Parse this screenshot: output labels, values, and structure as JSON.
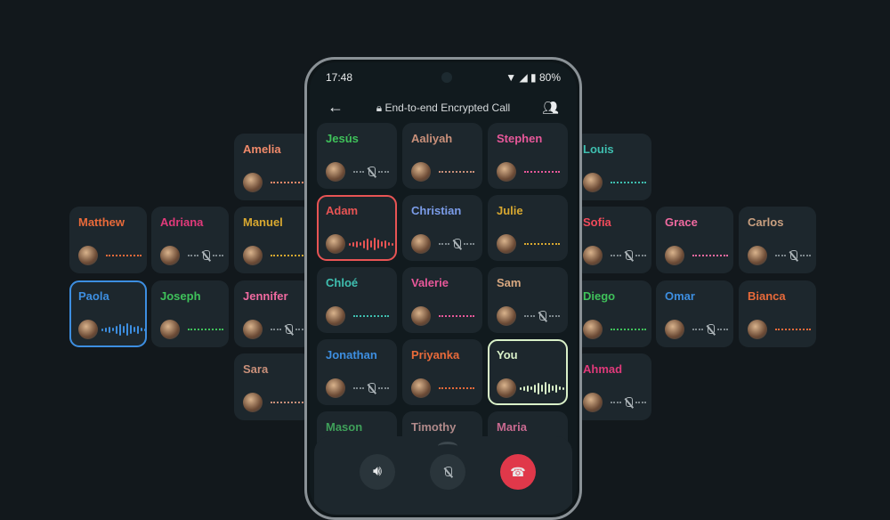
{
  "status_bar": {
    "time": "17:48",
    "battery": "80%",
    "icons": [
      "wifi-icon",
      "signal-icon",
      "battery-icon"
    ]
  },
  "header": {
    "back_icon": "arrow-left-icon",
    "lock_icon": "lock-icon",
    "title": "End-to-end Encrypted Call",
    "participants_icon": "people-icon"
  },
  "controls": {
    "speaker_icon": "speaker-icon",
    "mute_icon": "mic-off-icon",
    "end_call_icon": "phone-hangup-icon",
    "expand_icon": "chevron-up-icon",
    "end_call_color": "#e0384a"
  },
  "phone_tiles": [
    {
      "name": "Jesús",
      "color": "#3fc15a",
      "state": "muted"
    },
    {
      "name": "Aaliyah",
      "color": "#c9907a",
      "state": "dots"
    },
    {
      "name": "Stephen",
      "color": "#e8589a",
      "state": "dots"
    },
    {
      "name": "Adam",
      "color": "#e85454",
      "state": "speaking"
    },
    {
      "name": "Christian",
      "color": "#7b9ce8",
      "state": "muted"
    },
    {
      "name": "Julie",
      "color": "#d8a830",
      "state": "dots"
    },
    {
      "name": "Chloé",
      "color": "#3fbfb0",
      "state": "dots"
    },
    {
      "name": "Valerie",
      "color": "#e8589a",
      "state": "dots"
    },
    {
      "name": "Sam",
      "color": "#d8a880",
      "state": "muted"
    },
    {
      "name": "Jonathan",
      "color": "#3d8ee0",
      "state": "muted"
    },
    {
      "name": "Priyanka",
      "color": "#e86a3a",
      "state": "dots"
    },
    {
      "name": "You",
      "color": "#d9f0c8",
      "state": "speaking"
    },
    {
      "name": "Mason",
      "color": "#3fa05a",
      "state": "dots"
    },
    {
      "name": "Timothy",
      "color": "#b08a8a",
      "state": "dots"
    },
    {
      "name": "Maria",
      "color": "#c86a90",
      "state": "dots"
    }
  ],
  "left_tiles": [
    {
      "name": "Amelia",
      "color": "#f08a6a",
      "state": "dots"
    },
    {
      "name": "Matthew",
      "color": "#e86a3a",
      "state": "dots"
    },
    {
      "name": "Adriana",
      "color": "#e03a7a",
      "state": "muted"
    },
    {
      "name": "Manuel",
      "color": "#d8a830",
      "state": "dots"
    },
    {
      "name": "Paola",
      "color": "#3d8ee0",
      "state": "speaking"
    },
    {
      "name": "Joseph",
      "color": "#3fc15a",
      "state": "dots"
    },
    {
      "name": "Jennifer",
      "color": "#f06aa0",
      "state": "muted"
    },
    {
      "name": "Sara",
      "color": "#c9907a",
      "state": "dots"
    }
  ],
  "right_tiles": [
    {
      "name": "Louis",
      "color": "#3fbfb0",
      "state": "dots"
    },
    {
      "name": "Sofia",
      "color": "#f04a5a",
      "state": "muted"
    },
    {
      "name": "Grace",
      "color": "#f06aa0",
      "state": "dots"
    },
    {
      "name": "Carlos",
      "color": "#c9a080",
      "state": "muted"
    },
    {
      "name": "Diego",
      "color": "#3fc15a",
      "state": "dots"
    },
    {
      "name": "Omar",
      "color": "#3d8ee0",
      "state": "muted"
    },
    {
      "name": "Bianca",
      "color": "#e86a3a",
      "state": "dots"
    },
    {
      "name": "Ahmad",
      "color": "#e03a7a",
      "state": "muted"
    }
  ]
}
